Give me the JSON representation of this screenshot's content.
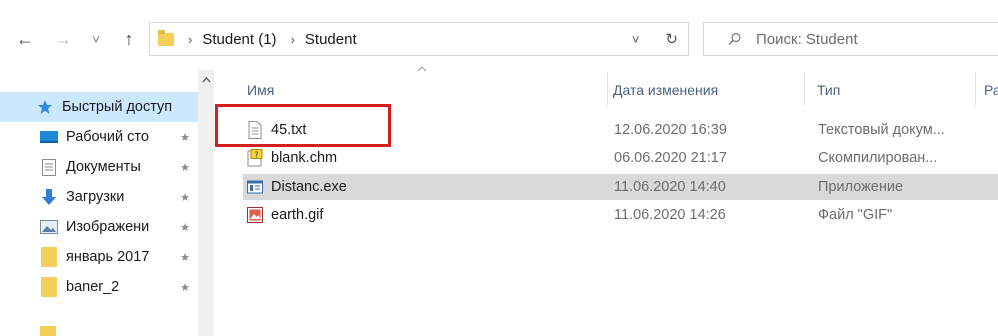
{
  "toolbar": {
    "back_glyph": "←",
    "forward_glyph": "→",
    "recent_glyph": "˅",
    "up_glyph": "↑",
    "breadcrumbs": [
      "Student (1)",
      "Student"
    ],
    "separator": "›",
    "dropdown_glyph": "˅",
    "refresh_glyph": "↻",
    "search_placeholder": "Поиск: Student"
  },
  "sidebar": {
    "items": [
      {
        "label": "Быстрый доступ",
        "icon": "star-icon",
        "active": true,
        "pinned": false
      },
      {
        "label": "Рабочий сто",
        "icon": "desktop-icon",
        "active": false,
        "pinned": true
      },
      {
        "label": "Документы",
        "icon": "documents-icon",
        "active": false,
        "pinned": true
      },
      {
        "label": "Загрузки",
        "icon": "download-icon",
        "active": false,
        "pinned": true
      },
      {
        "label": "Изображени",
        "icon": "pictures-icon",
        "active": false,
        "pinned": true
      },
      {
        "label": "январь 2017",
        "icon": "folder-icon",
        "active": false,
        "pinned": true
      },
      {
        "label": "baner_2",
        "icon": "folder-icon",
        "active": false,
        "pinned": true
      }
    ],
    "pin_glyph": "★"
  },
  "columns": {
    "name": "Имя",
    "date": "Дата изменения",
    "type": "Тип",
    "size": "Ра"
  },
  "files": [
    {
      "name": "45.txt",
      "date": "12.06.2020 16:39",
      "type": "Текстовый докум...",
      "icon": "text-file-icon",
      "selected": false
    },
    {
      "name": "blank.chm",
      "date": "06.06.2020 21:17",
      "type": "Скомпилирован...",
      "icon": "help-file-icon",
      "selected": false
    },
    {
      "name": "Distanc.exe",
      "date": "11.06.2020 14:40",
      "type": "Приложение",
      "icon": "application-icon",
      "selected": true
    },
    {
      "name": "earth.gif",
      "date": "11.06.2020 14:26",
      "type": "Файл \"GIF\"",
      "icon": "image-file-icon",
      "selected": false
    }
  ]
}
